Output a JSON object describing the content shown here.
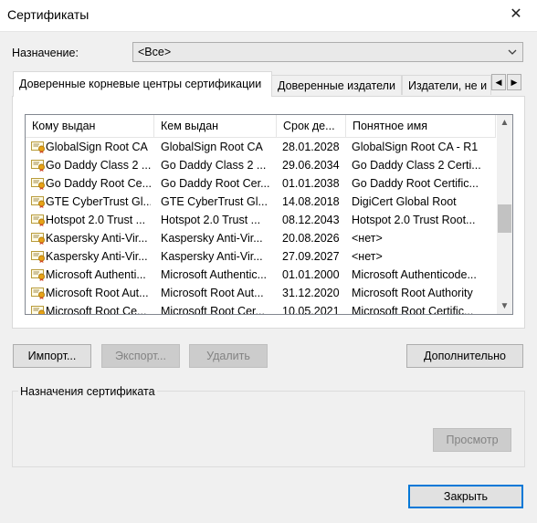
{
  "window": {
    "title": "Сертификаты"
  },
  "purpose": {
    "label": "Назначение:",
    "value": "<Все>"
  },
  "tabs": [
    {
      "label": "Доверенные корневые центры сертификации"
    },
    {
      "label": "Доверенные издатели"
    },
    {
      "label": "Издатели, не и"
    }
  ],
  "list": {
    "columns": [
      "Кому выдан",
      "Кем выдан",
      "Срок де...",
      "Понятное имя"
    ],
    "rows": [
      {
        "issued_to": "GlobalSign Root CA",
        "issued_by": "GlobalSign Root CA",
        "expires": "28.01.2028",
        "friendly": "GlobalSign Root CA - R1"
      },
      {
        "issued_to": "Go Daddy Class 2 ...",
        "issued_by": "Go Daddy Class 2 ...",
        "expires": "29.06.2034",
        "friendly": "Go Daddy Class 2 Certi..."
      },
      {
        "issued_to": "Go Daddy Root Ce...",
        "issued_by": "Go Daddy Root Cer...",
        "expires": "01.01.2038",
        "friendly": "Go Daddy Root Certific..."
      },
      {
        "issued_to": "GTE CyberTrust Gl...",
        "issued_by": "GTE CyberTrust Gl...",
        "expires": "14.08.2018",
        "friendly": "DigiCert Global Root"
      },
      {
        "issued_to": "Hotspot 2.0 Trust ...",
        "issued_by": "Hotspot 2.0 Trust ...",
        "expires": "08.12.2043",
        "friendly": "Hotspot 2.0 Trust Root..."
      },
      {
        "issued_to": "Kaspersky Anti-Vir...",
        "issued_by": "Kaspersky Anti-Vir...",
        "expires": "20.08.2026",
        "friendly": "<нет>"
      },
      {
        "issued_to": "Kaspersky Anti-Vir...",
        "issued_by": "Kaspersky Anti-Vir...",
        "expires": "27.09.2027",
        "friendly": "<нет>"
      },
      {
        "issued_to": "Microsoft Authenti...",
        "issued_by": "Microsoft Authentic...",
        "expires": "01.01.2000",
        "friendly": "Microsoft Authenticode..."
      },
      {
        "issued_to": "Microsoft Root Aut...",
        "issued_by": "Microsoft Root Aut...",
        "expires": "31.12.2020",
        "friendly": "Microsoft Root Authority"
      },
      {
        "issued_to": "Microsoft Root Ce...",
        "issued_by": "Microsoft Root Cer...",
        "expires": "10.05.2021",
        "friendly": "Microsoft Root Certific..."
      }
    ]
  },
  "buttons": {
    "import": "Импорт...",
    "export": "Экспорт...",
    "delete": "Удалить",
    "advanced": "Дополнительно",
    "view": "Просмотр",
    "close": "Закрыть"
  },
  "cert_purposes": {
    "title": "Назначения сертификата"
  },
  "icons": {
    "close": "close-icon",
    "dropdown": "chevron-down-icon",
    "cert": "certificate-icon",
    "scroll_up": "scroll-up-icon",
    "scroll_down": "scroll-down-icon",
    "tab_left": "tab-scroll-left-icon",
    "tab_right": "tab-scroll-right-icon"
  },
  "colors": {
    "default_button_border": "#0078d7",
    "cert_ribbon": "#e8a317"
  }
}
